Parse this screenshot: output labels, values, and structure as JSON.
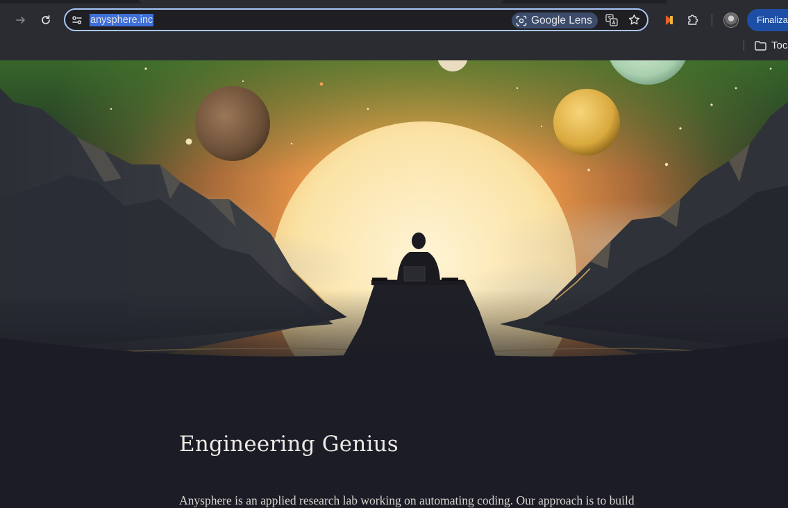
{
  "browser": {
    "url": "anysphere.inc",
    "lens_label": "Google Lens",
    "finalize_label": "Finaliza",
    "bookmark_folder": "Toc"
  },
  "page": {
    "title": "Engineering Genius",
    "intro": "Anysphere is an applied research lab working on automating coding. Our approach is to build"
  },
  "colors": {
    "accent": "#a8c7fa",
    "url_selection": "#3e6fd8",
    "page_background": "#1b1c25",
    "sun": "#fbe7b5"
  },
  "icons": [
    "forward-arrow-icon",
    "reload-icon",
    "site-settings-icon",
    "google-lens-icon",
    "translate-icon",
    "bookmark-star-icon",
    "extension-icon",
    "puzzle-icon",
    "folder-icon"
  ]
}
